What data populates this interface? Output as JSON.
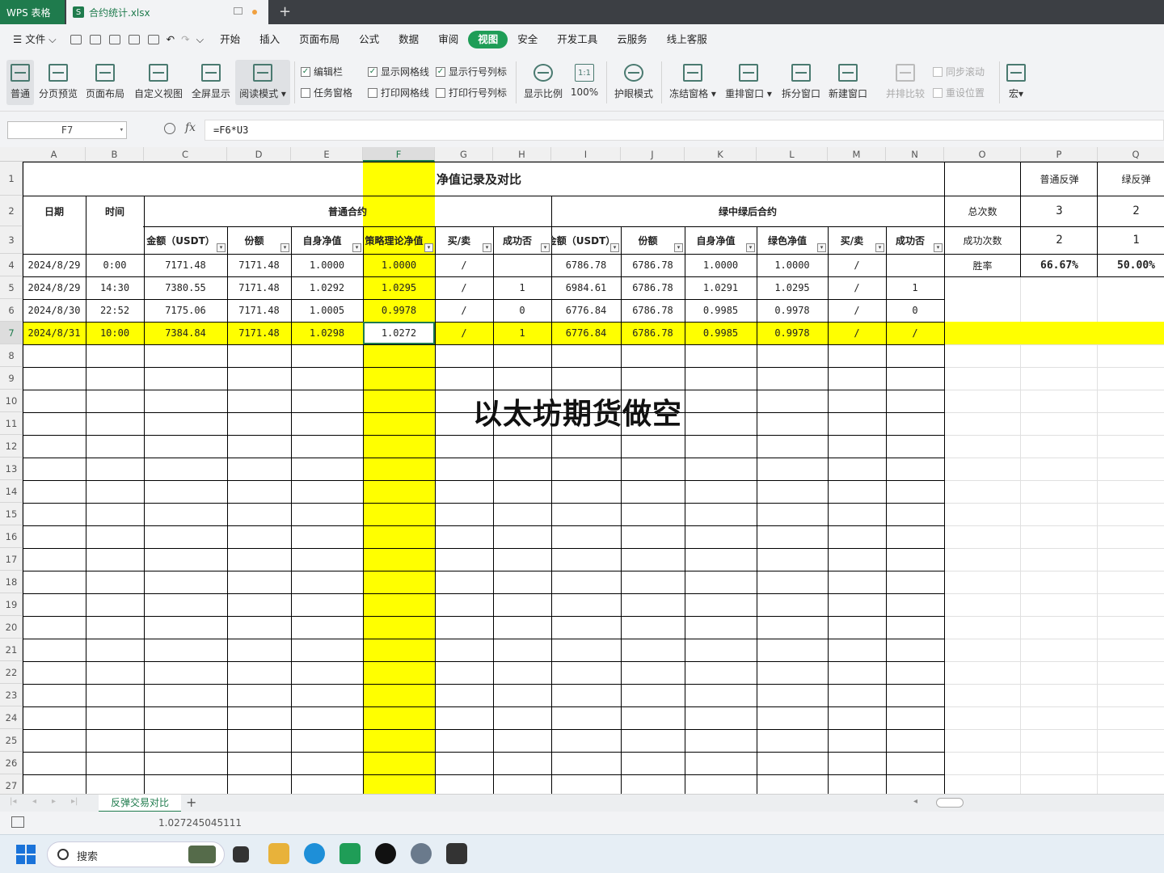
{
  "titlebar": {
    "app_tab": "WPS 表格",
    "file_tab": "合约统计.xlsx",
    "new_tab": "+"
  },
  "menubar": {
    "file_menu": "文件",
    "items": [
      "开始",
      "插入",
      "页面布局",
      "公式",
      "数据",
      "审阅",
      "视图",
      "安全",
      "开发工具",
      "云服务",
      "线上客服"
    ],
    "active": "视图"
  },
  "ribbon": {
    "normal": "普通",
    "page_break": "分页预览",
    "page_layout": "页面布局",
    "custom_view": "自定义视图",
    "fullscreen": "全屏显示",
    "reading_mode": "阅读模式",
    "edit_bar": "编辑栏",
    "task_pane": "任务窗格",
    "show_gridlines": "显示网格线",
    "print_gridlines": "打印网格线",
    "show_headings": "显示行号列标",
    "print_headings": "打印行号列标",
    "zoom": "显示比例",
    "zoom_100": "100%",
    "zoom_100_icon": "1:1",
    "eye_mode": "护眼模式",
    "freeze": "冻结窗格",
    "arrange": "重排窗口",
    "split": "拆分窗口",
    "new_window": "新建窗口",
    "side_by_side": "并排比较",
    "sync_scroll": "同步滚动",
    "reset_pos": "重设位置",
    "macro": "宏"
  },
  "formula_bar": {
    "name_box": "F7",
    "fx": "fx",
    "formula": "=F6*U3"
  },
  "columns": [
    "A",
    "B",
    "C",
    "D",
    "E",
    "F",
    "G",
    "H",
    "I",
    "J",
    "K",
    "L",
    "M",
    "N",
    "O",
    "P",
    "Q"
  ],
  "rows": [
    "1",
    "2",
    "3",
    "4",
    "5",
    "6",
    "7",
    "8",
    "9",
    "10",
    "11",
    "12",
    "13",
    "14",
    "15",
    "16",
    "17",
    "18",
    "19",
    "20",
    "21",
    "22",
    "23",
    "24",
    "25",
    "26",
    "27"
  ],
  "sheet": {
    "title": "净值记录及对比",
    "date_hdr": "日期",
    "time_hdr": "时间",
    "group_normal": "普通合约",
    "group_green": "绿中绿后合约",
    "sub_headers": [
      "金额（USDT）",
      "份额",
      "自身净值",
      "策略理论净值",
      "买/卖",
      "成功否",
      "金额（USDT）",
      "份额",
      "自身净值",
      "绿色净值",
      "买/卖",
      "成功否"
    ],
    "data_rows": [
      [
        "2024/8/29",
        "0:00",
        "7171.48",
        "7171.48",
        "1.0000",
        "1.0000",
        "/",
        "",
        "6786.78",
        "6786.78",
        "1.0000",
        "1.0000",
        "/",
        ""
      ],
      [
        "2024/8/29",
        "14:30",
        "7380.55",
        "7171.48",
        "1.0292",
        "1.0295",
        "/",
        "1",
        "6984.61",
        "6786.78",
        "1.0291",
        "1.0295",
        "/",
        "1"
      ],
      [
        "2024/8/30",
        "22:52",
        "7175.06",
        "7171.48",
        "1.0005",
        "0.9978",
        "/",
        "0",
        "6776.84",
        "6786.78",
        "0.9985",
        "0.9978",
        "/",
        "0"
      ],
      [
        "2024/8/31",
        "10:00",
        "7384.84",
        "7171.48",
        "1.0298",
        "1.0272",
        "/",
        "1",
        "6776.84",
        "6786.78",
        "0.9985",
        "0.9978",
        "/",
        "/"
      ]
    ],
    "summary": {
      "col_p": "普通反弹",
      "col_q": "绿反弹",
      "total_label": "总次数",
      "total_p": "3",
      "total_q": "2",
      "success_label": "成功次数",
      "success_p": "2",
      "success_q": "1",
      "rate_label": "胜率",
      "rate_p": "66.67%",
      "rate_q": "50.00%"
    }
  },
  "overlay_text": "以太坊期货做空",
  "sheet_tab": "反弹交易对比",
  "add_sheet": "+",
  "status_value": "1.027245045111",
  "taskbar": {
    "search_label": "搜索"
  },
  "colors": {
    "accent": "#1f7b4d",
    "highlight": "#ffff00"
  }
}
